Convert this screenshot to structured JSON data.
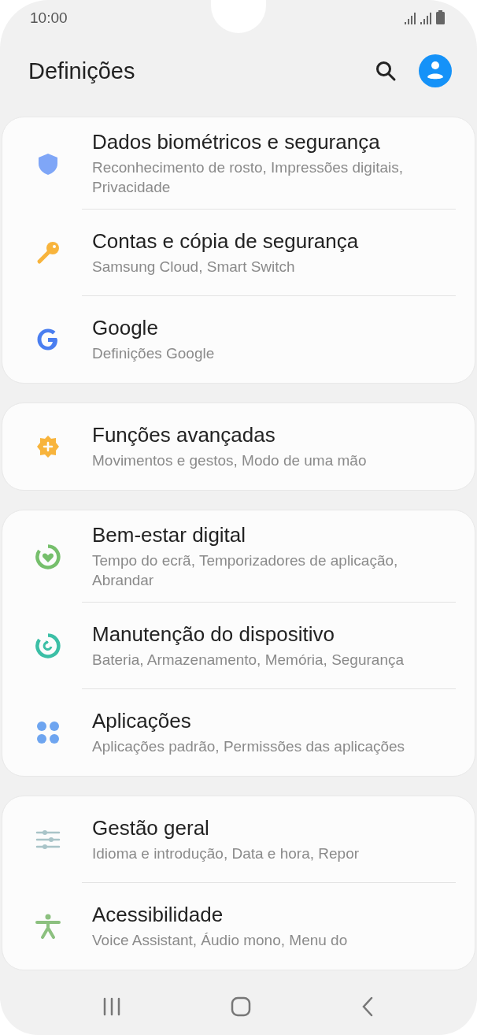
{
  "status_bar": {
    "time": "10:00"
  },
  "header": {
    "title": "Definições"
  },
  "groups": [
    {
      "items": [
        {
          "kind": "shield",
          "title": "Dados biométricos e segurança",
          "subtitle": "Reconhecimento de rosto, Impressões digitais, Privacidade"
        },
        {
          "kind": "key",
          "title": "Contas e cópia de segurança",
          "subtitle": "Samsung Cloud, Smart Switch"
        },
        {
          "kind": "google",
          "title": "Google",
          "subtitle": "Definições Google"
        }
      ]
    },
    {
      "items": [
        {
          "kind": "gear",
          "title": "Funções avançadas",
          "subtitle": "Movimentos e gestos, Modo de uma mão"
        }
      ]
    },
    {
      "items": [
        {
          "kind": "wellbeing",
          "title": "Bem-estar digital",
          "subtitle": "Tempo do ecrã, Temporizadores de aplicação, Abrandar"
        },
        {
          "kind": "care",
          "title": "Manutenção do dispositivo",
          "subtitle": "Bateria, Armazenamento, Memória, Segurança"
        },
        {
          "kind": "apps",
          "title": "Aplicações",
          "subtitle": "Aplicações padrão, Permissões das aplicações"
        }
      ]
    },
    {
      "items": [
        {
          "kind": "sliders",
          "title": "Gestão geral",
          "subtitle": "Idioma e introdução, Data e hora, Repor"
        },
        {
          "kind": "accessibility",
          "title": "Acessibilidade",
          "subtitle": "Voice Assistant, Áudio mono, Menu do"
        }
      ]
    }
  ]
}
